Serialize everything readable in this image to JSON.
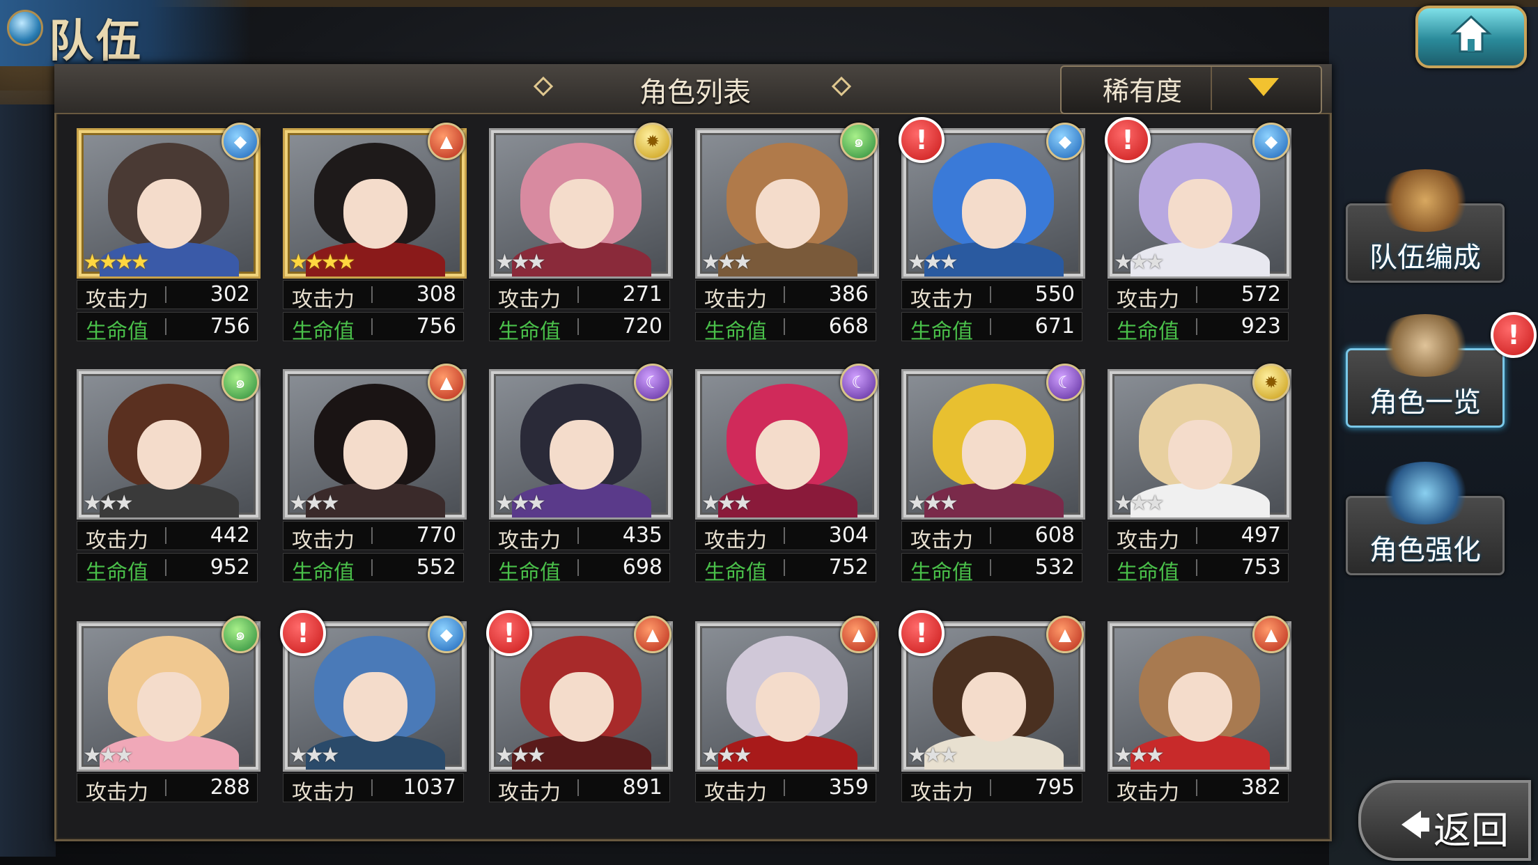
{
  "title": "队伍",
  "header": {
    "title": "角色列表",
    "sort_label": "稀有度"
  },
  "stat_labels": {
    "atk": "攻击力",
    "hp": "生命值"
  },
  "side_menu": {
    "team_build": "队伍编成",
    "char_list": "角色一览",
    "char_enhance": "角色强化"
  },
  "back_label": "返回",
  "alert_mark": "!",
  "colors": {
    "hp_green": "#4ac04a",
    "sort_arrow": "#f2c230",
    "alert_red": "#c81818"
  },
  "cards": [
    {
      "stars": "★★★★",
      "rarity": 4,
      "element": "water",
      "atk": "302",
      "hp": "756",
      "alert": false,
      "hair": "#4a3a34",
      "outfit": "#3a5aa8"
    },
    {
      "stars": "★★★★",
      "rarity": 4,
      "element": "fire",
      "atk": "308",
      "hp": "756",
      "alert": false,
      "hair": "#1e1a1a",
      "outfit": "#8a1a1a"
    },
    {
      "stars": "★★★",
      "rarity": 3,
      "element": "light",
      "atk": "271",
      "hp": "720",
      "alert": false,
      "hair": "#d88aa0",
      "outfit": "#8a2a3a"
    },
    {
      "stars": "★★★",
      "rarity": 3,
      "element": "wind",
      "atk": "386",
      "hp": "668",
      "alert": false,
      "hair": "#b07a4a",
      "outfit": "#7a5a3a"
    },
    {
      "stars": "★★★",
      "rarity": 3,
      "element": "water",
      "atk": "550",
      "hp": "671",
      "alert": true,
      "hair": "#3a7ad8",
      "outfit": "#2a5aa0"
    },
    {
      "stars": "★★★",
      "rarity": 3,
      "element": "water",
      "atk": "572",
      "hp": "923",
      "alert": true,
      "hair": "#b8a8e0",
      "outfit": "#e8e8f0"
    },
    {
      "stars": "★★★",
      "rarity": 3,
      "element": "wind",
      "atk": "442",
      "hp": "952",
      "alert": false,
      "hair": "#5a3020",
      "outfit": "#3a3a3a"
    },
    {
      "stars": "★★★",
      "rarity": 3,
      "element": "fire",
      "atk": "770",
      "hp": "552",
      "alert": false,
      "hair": "#1a1414",
      "outfit": "#3a2a2a"
    },
    {
      "stars": "★★★",
      "rarity": 3,
      "element": "dark",
      "atk": "435",
      "hp": "698",
      "alert": false,
      "hair": "#2a2a38",
      "outfit": "#5a3a8a"
    },
    {
      "stars": "★★★",
      "rarity": 3,
      "element": "dark",
      "atk": "304",
      "hp": "752",
      "alert": false,
      "hair": "#d02a5a",
      "outfit": "#8a1a3a"
    },
    {
      "stars": "★★★",
      "rarity": 3,
      "element": "dark",
      "atk": "608",
      "hp": "532",
      "alert": false,
      "hair": "#e8c030",
      "outfit": "#7a2a4a"
    },
    {
      "stars": "★★★",
      "rarity": 3,
      "element": "light",
      "atk": "497",
      "hp": "753",
      "alert": false,
      "hair": "#e8d0a0",
      "outfit": "#f0f0f0"
    },
    {
      "stars": "★★★",
      "rarity": 3,
      "element": "wind",
      "atk": "288",
      "hp": "",
      "alert": false,
      "hair": "#f0c890",
      "outfit": "#f0a8b8"
    },
    {
      "stars": "★★★",
      "rarity": 3,
      "element": "water",
      "atk": "1037",
      "hp": "",
      "alert": true,
      "hair": "#4a7ab8",
      "outfit": "#2a4a6a"
    },
    {
      "stars": "★★★",
      "rarity": 3,
      "element": "fire",
      "atk": "891",
      "hp": "",
      "alert": true,
      "hair": "#a82a2a",
      "outfit": "#5a1a1a"
    },
    {
      "stars": "★★★",
      "rarity": 3,
      "element": "fire",
      "atk": "359",
      "hp": "",
      "alert": false,
      "hair": "#d0c8d8",
      "outfit": "#a81a1a"
    },
    {
      "stars": "★★★",
      "rarity": 3,
      "element": "fire",
      "atk": "795",
      "hp": "",
      "alert": true,
      "hair": "#4a3020",
      "outfit": "#e8e0d0"
    },
    {
      "stars": "★★★",
      "rarity": 3,
      "element": "fire",
      "atk": "382",
      "hp": "",
      "alert": false,
      "hair": "#a87a50",
      "outfit": "#c82a2a"
    }
  ]
}
